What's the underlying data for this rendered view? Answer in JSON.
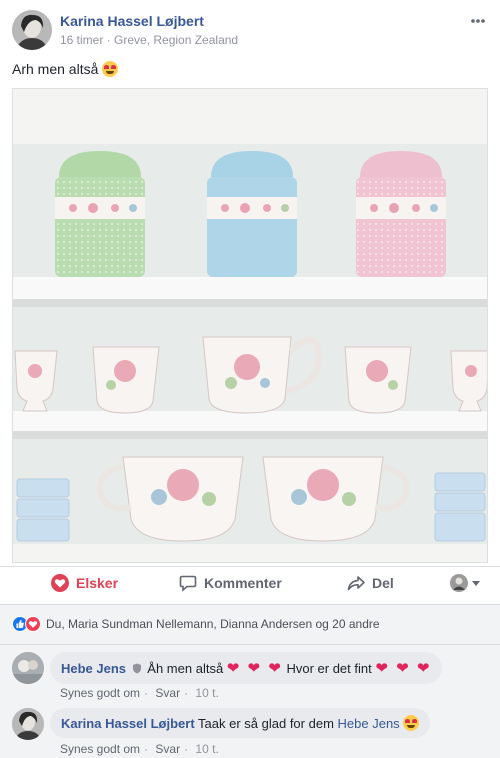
{
  "post": {
    "author": "Karina Hassel Løjbert",
    "meta": "16 timer · Greve, Region Zealand",
    "text": "Arh men altså"
  },
  "actions": {
    "love_label": "Elsker",
    "comment_label": "Kommenter",
    "share_label": "Del"
  },
  "reactions": {
    "summary": "Du, Maria Sundman Nellemann, Dianna Andersen og 20 andre"
  },
  "comments": [
    {
      "name": "Hebe Jens",
      "text_a": "Åh men altså",
      "hearts_a": "❤ ❤ ❤",
      "text_b": "Hvor er det fint",
      "hearts_b": "❤ ❤ ❤",
      "like_label": "Synes godt om",
      "reply_label": "Svar",
      "time": "10 t."
    },
    {
      "name": "Karina Hassel Løjbert",
      "text": "Taak er så glad for dem",
      "mention": "Hebe Jens",
      "like_label": "Synes godt om",
      "reply_label": "Svar",
      "time": "10 t."
    }
  ],
  "colors": {
    "link": "#385898",
    "love": "#e04255",
    "like_badge": "#1877f2",
    "heart": "#e0245e"
  }
}
